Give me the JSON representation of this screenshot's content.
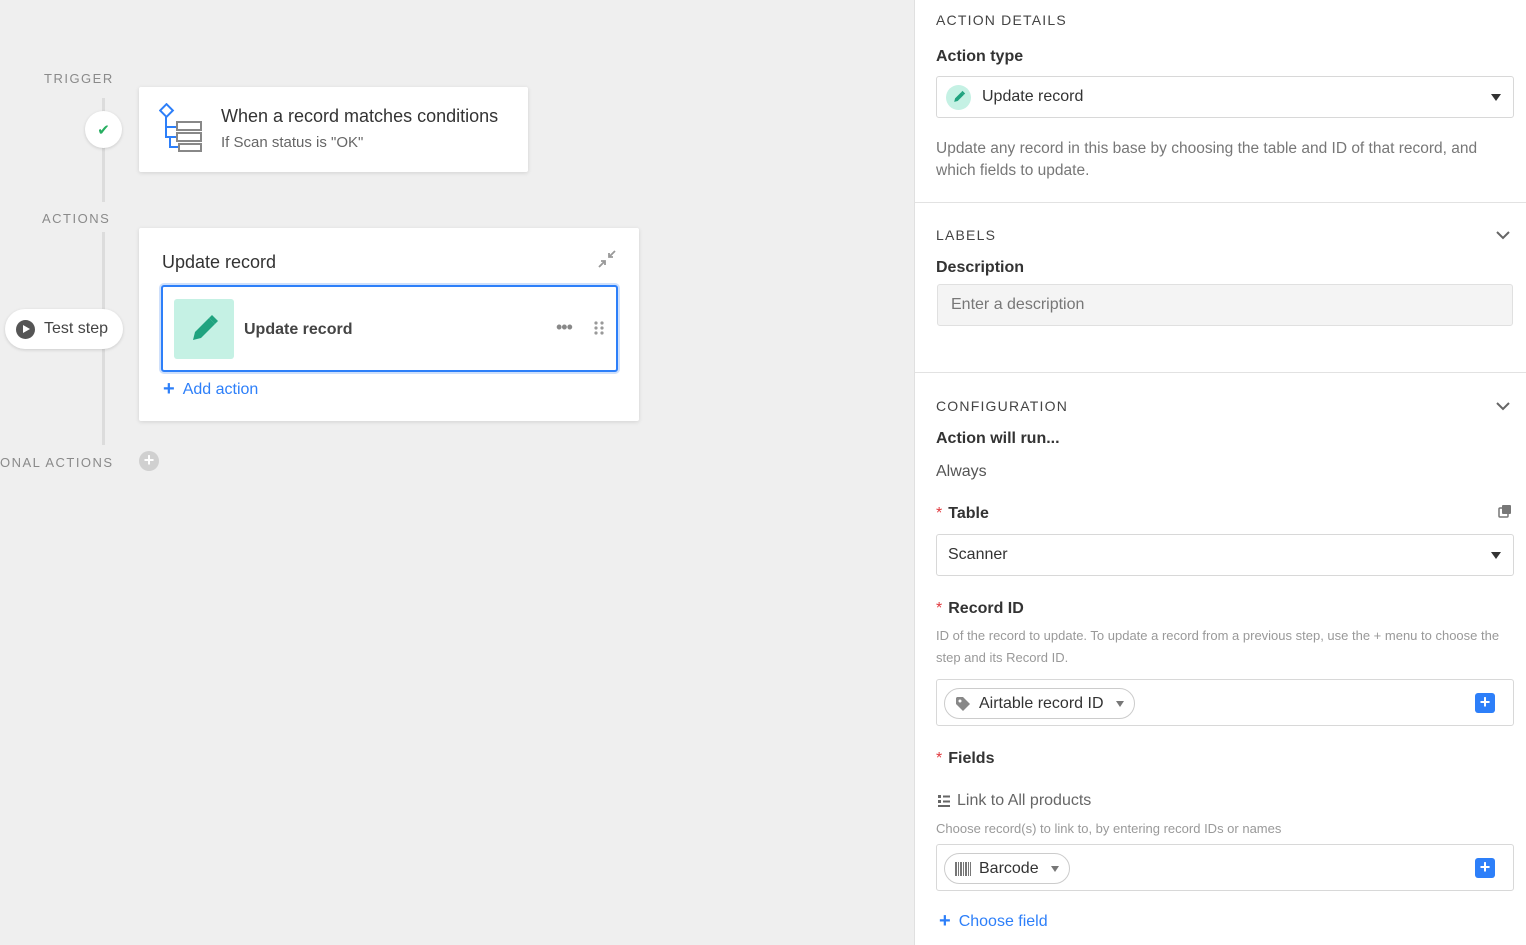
{
  "canvas": {
    "trigger_label": "TRIGGER",
    "actions_label": "ACTIONS",
    "conditional_label": "ONAL ACTIONS",
    "trigger_card": {
      "title": "When a record matches conditions",
      "subtitle": "If Scan status is \"OK\""
    },
    "action_card": {
      "title": "Update record",
      "item_label": "Update record",
      "add_action": "Add action"
    },
    "test_step": "Test step"
  },
  "panel": {
    "action_details_title": "ACTION DETAILS",
    "action_type_label": "Action type",
    "action_type_value": "Update record",
    "action_description": "Update any record in this base by choosing the table and ID of that record, and which fields to update.",
    "labels_title": "LABELS",
    "description_label": "Description",
    "description_placeholder": "Enter a description",
    "configuration_title": "CONFIGURATION",
    "action_will_run_label": "Action will run...",
    "action_will_run_value": "Always",
    "table_label": "Table",
    "table_value": "Scanner",
    "record_id_label": "Record ID",
    "record_id_help": "ID of the record to update. To update a record from a previous step, use the + menu to choose the step and its Record ID.",
    "record_id_token": "Airtable record ID",
    "fields_label": "Fields",
    "link_field_label": "Link to All products",
    "link_field_help": "Choose record(s) to link to, by entering record IDs or names",
    "link_field_token": "Barcode",
    "choose_field": "Choose field"
  },
  "colors": {
    "accent": "#2d7ff9",
    "required": "#e0393e",
    "teal_bg": "#c5f1e4",
    "teal_icon": "#20a37f",
    "success": "#27ae60"
  }
}
